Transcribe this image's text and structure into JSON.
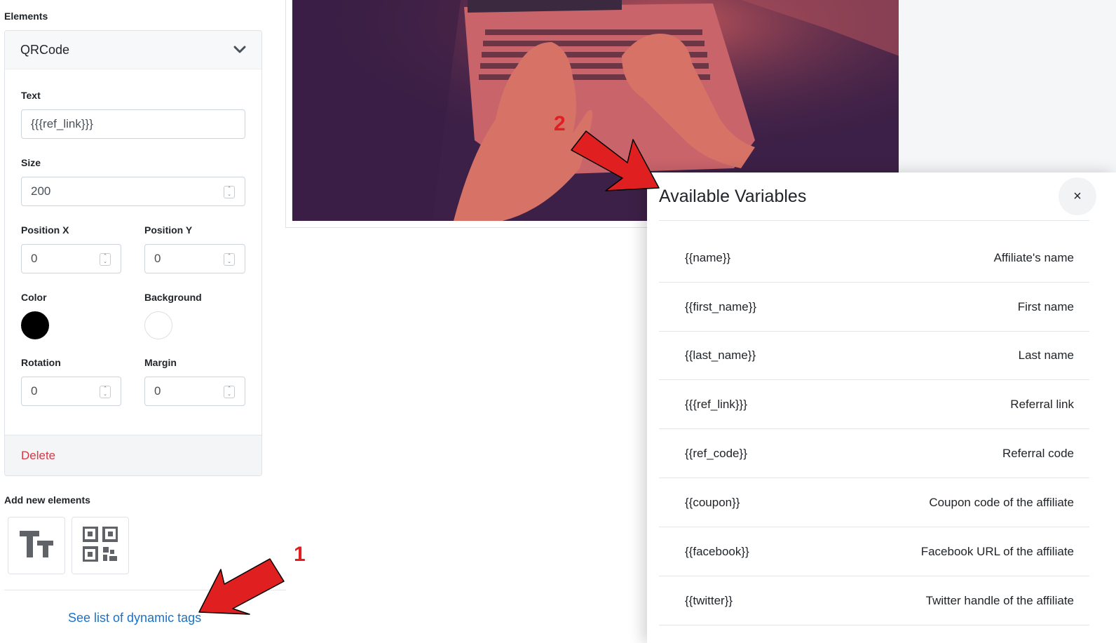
{
  "sidebar": {
    "elements_heading": "Elements",
    "element_card": {
      "title": "QRCode",
      "text_label": "Text",
      "text_value": "{{{ref_link}}}",
      "size_label": "Size",
      "size_value": "200",
      "posx_label": "Position X",
      "posx_value": "0",
      "posy_label": "Position Y",
      "posy_value": "0",
      "color_label": "Color",
      "color_value": "#000000",
      "background_label": "Background",
      "background_value": "#ffffff",
      "rotation_label": "Rotation",
      "rotation_value": "0",
      "margin_label": "Margin",
      "margin_value": "0",
      "delete_label": "Delete"
    },
    "add_heading": "Add new elements",
    "tools": [
      {
        "icon": "text-element-icon"
      },
      {
        "icon": "qrcode-element-icon"
      }
    ],
    "dynamic_tags_link": "See list of dynamic tags"
  },
  "modal": {
    "title": "Available Variables",
    "close_label": "×",
    "variables": [
      {
        "tag": "{{name}}",
        "description": "Affiliate's name"
      },
      {
        "tag": "{{first_name}}",
        "description": "First name"
      },
      {
        "tag": "{{last_name}}",
        "description": "Last name"
      },
      {
        "tag": "{{{ref_link}}}",
        "description": "Referral link"
      },
      {
        "tag": "{{ref_code}}",
        "description": "Referral code"
      },
      {
        "tag": "{{coupon}}",
        "description": "Coupon code of the affiliate"
      },
      {
        "tag": "{{facebook}}",
        "description": "Facebook URL of the affiliate"
      },
      {
        "tag": "{{twitter}}",
        "description": "Twitter handle of the affiliate"
      }
    ]
  },
  "annotations": {
    "marker_1": "1",
    "marker_2": "2",
    "arrow_color": "#e02020"
  },
  "colors": {
    "link": "#1a73c9",
    "danger": "#dc3545",
    "image_tint": "#3e2148"
  }
}
